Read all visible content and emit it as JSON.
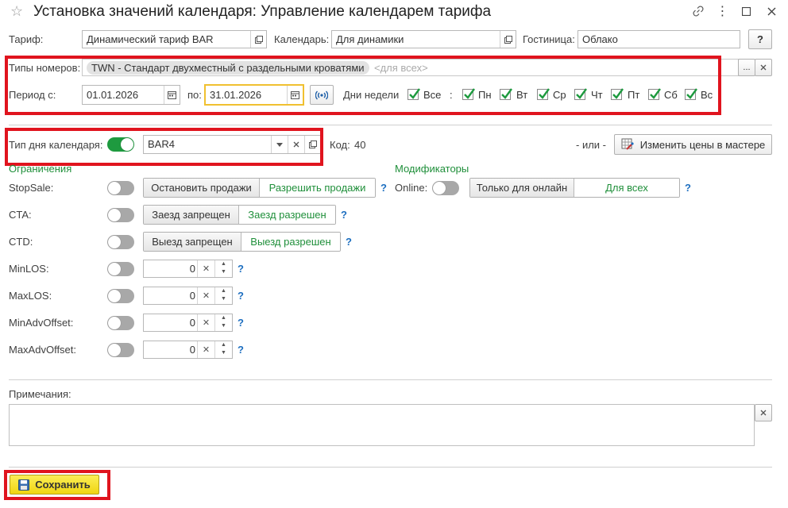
{
  "window": {
    "title": "Установка значений календаря: Управление календарем тарифа"
  },
  "header": {
    "tariff_label": "Тариф:",
    "tariff_value": "Динамический тариф BAR",
    "calendar_label": "Календарь:",
    "calendar_value": "Для динамики",
    "hotel_label": "Гостиница:",
    "hotel_value": "Облако",
    "help_label": "?"
  },
  "room_types": {
    "label": "Типы номеров:",
    "chip": "TWN - Стандарт двухместный с раздельными кроватями",
    "placeholder": "<для всех>",
    "more": "..."
  },
  "period": {
    "from_label": "Период с:",
    "from_value": "01.01.2026",
    "to_label": "по:",
    "to_value": "31.01.2026",
    "weekdays_label": "Дни недели",
    "all_label": "Все",
    "colon": ":",
    "days": [
      {
        "label": "Пн",
        "checked": true
      },
      {
        "label": "Вт",
        "checked": true
      },
      {
        "label": "Ср",
        "checked": true
      },
      {
        "label": "Чт",
        "checked": true
      },
      {
        "label": "Пт",
        "checked": true
      },
      {
        "label": "Сб",
        "checked": true
      },
      {
        "label": "Вс",
        "checked": true
      }
    ]
  },
  "day_type": {
    "label": "Тип дня календаря:",
    "enabled": true,
    "value": "BAR4",
    "code_label": "Код:",
    "code_value": "40",
    "or_label": "- или -",
    "wizard_button": "Изменить цены в мастере"
  },
  "restrictions": {
    "header": "Ограничения",
    "stopsale": {
      "label": "StopSale:",
      "opt1": "Остановить продажи",
      "opt2": "Разрешить продажи"
    },
    "cta": {
      "label": "CTA:",
      "opt1": "Заезд запрещен",
      "opt2": "Заезд разрешен"
    },
    "ctd": {
      "label": "CTD:",
      "opt1": "Выезд запрещен",
      "opt2": "Выезд разрешен"
    },
    "minlos": {
      "label": "MinLOS:",
      "value": "0"
    },
    "maxlos": {
      "label": "MaxLOS:",
      "value": "0"
    },
    "minadv": {
      "label": "MinAdvOffset:",
      "value": "0"
    },
    "maxadv": {
      "label": "MaxAdvOffset:",
      "value": "0"
    },
    "help": "?"
  },
  "modifiers": {
    "header": "Модификаторы",
    "online_label": "Online:",
    "opt1": "Только для онлайн",
    "opt2": "Для всех"
  },
  "notes": {
    "label": "Примечания:",
    "value": ""
  },
  "footer": {
    "save_button": "Сохранить"
  },
  "colors": {
    "accent_green": "#1e9a3f",
    "highlight_red": "#e0141e",
    "save_yellow": "#f6e21c",
    "link_blue": "#1e6fc0"
  }
}
